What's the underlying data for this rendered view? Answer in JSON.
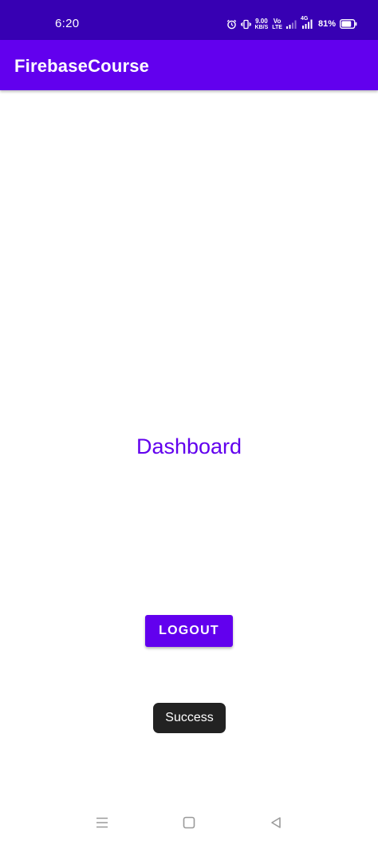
{
  "status_bar": {
    "time": "6:20",
    "network_speed_value": "9.00",
    "network_speed_unit": "KB/S",
    "volte_top": "Vo",
    "volte_bottom": "LTE",
    "signal_label": "4G",
    "battery_percent": "81%",
    "battery_level": 0.81,
    "icons": [
      "alarm-icon",
      "vibrate-icon",
      "network-speed",
      "volte-icon",
      "signal-icon",
      "signal-4g-icon",
      "battery-icon"
    ]
  },
  "app_bar": {
    "title": "FirebaseCourse"
  },
  "main": {
    "heading": "Dashboard",
    "logout_label": "LOGOUT"
  },
  "toast": {
    "message": "Success"
  },
  "nav_bar": {
    "icons": [
      "menu-icon",
      "home-icon",
      "back-icon"
    ]
  },
  "colors": {
    "status_bar": "#3700b3",
    "primary": "#6200ee",
    "toast_bg": "#222222",
    "background": "#ffffff"
  }
}
